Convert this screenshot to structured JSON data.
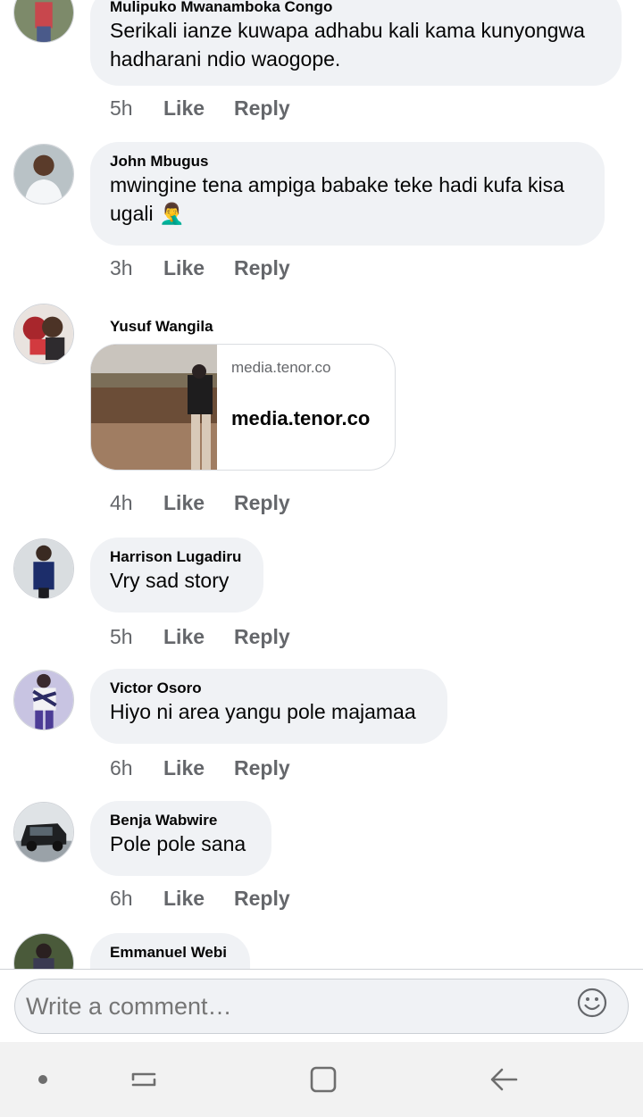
{
  "comments": [
    {
      "author": "Mulipuko Mwanamboka Congo",
      "text": "Serikali ianze kuwapa adhabu kali kama kunyongwa hadharani ndio waogope.",
      "time": "5h",
      "like": "Like",
      "reply": "Reply"
    },
    {
      "author": "John Mbugus",
      "text": "mwingine tena ampiga babake teke hadi kufa kisa ugali 🤦‍♂️",
      "time": "3h",
      "like": "Like",
      "reply": "Reply"
    },
    {
      "author": "Yusuf Wangila",
      "link_domain": "media.tenor.co",
      "link_title": "media.tenor.co",
      "time": "4h",
      "like": "Like",
      "reply": "Reply"
    },
    {
      "author": "Harrison Lugadiru",
      "text": "Vry sad story",
      "time": "5h",
      "like": "Like",
      "reply": "Reply"
    },
    {
      "author": "Victor Osoro",
      "text": "Hiyo ni area yangu pole majamaa",
      "time": "6h",
      "like": "Like",
      "reply": "Reply"
    },
    {
      "author": "Benja Wabwire",
      "text": "Pole pole sana",
      "time": "6h",
      "like": "Like",
      "reply": "Reply"
    },
    {
      "author": "Emmanuel Webi"
    }
  ],
  "composer": {
    "placeholder": "Write a comment…",
    "emoji_icon": "smiley-icon"
  },
  "nav_icons": [
    "dot-icon",
    "recent-apps-icon",
    "home-icon",
    "back-icon"
  ],
  "colors": {
    "bubble": "#f0f2f5",
    "meta": "#65676b",
    "text": "#050505"
  }
}
